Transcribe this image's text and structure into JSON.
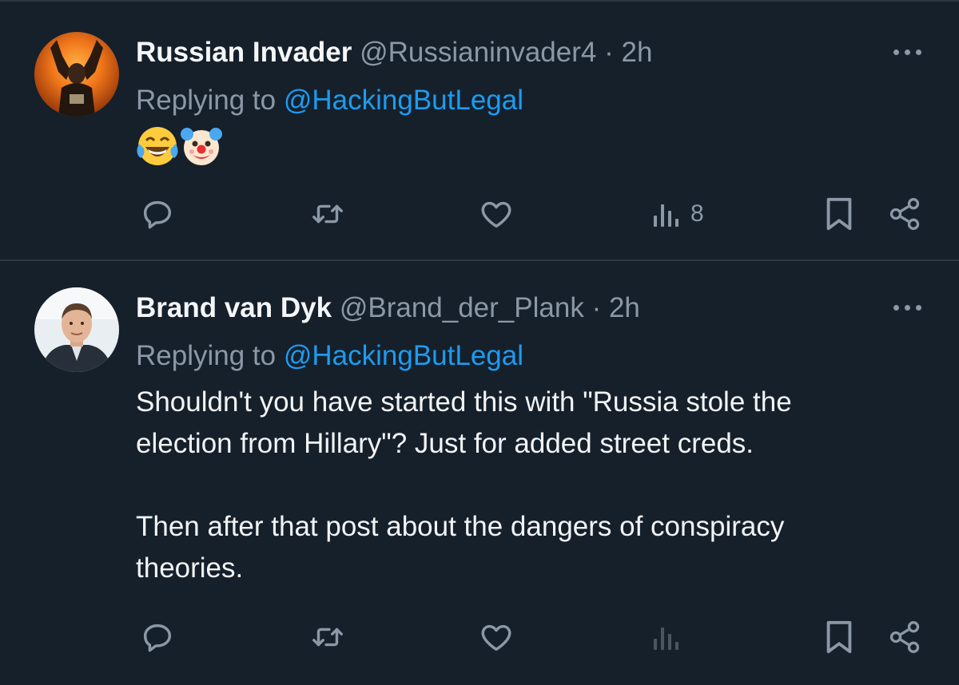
{
  "tweets": [
    {
      "author": {
        "name": "Russian Invader",
        "handle": "@Russianinvader4"
      },
      "separator": "·",
      "time": "2h",
      "replying_prefix": "Replying to",
      "replying_to": "@HackingButLegal",
      "emojis": [
        "face-with-tears-of-joy",
        "clown-face"
      ],
      "actions": {
        "views_count": "8"
      }
    },
    {
      "author": {
        "name": "Brand van Dyk",
        "handle": "@Brand_der_Plank"
      },
      "separator": "·",
      "time": "2h",
      "replying_prefix": "Replying to",
      "replying_to": "@HackingButLegal",
      "text_lines": [
        "Shouldn't you have started this with \"Russia stole the",
        "election from Hillary\"? Just for added street creds.",
        "Then after that post about the dangers of conspiracy",
        "theories."
      ],
      "actions": {
        "views_count": ""
      }
    }
  ],
  "colors": {
    "background": "#16202b",
    "text_primary": "#f2f4f6",
    "text_secondary": "#8b98a5",
    "link": "#1d9bf0",
    "divider": "#2f3943"
  },
  "icons": [
    "reply-icon",
    "retweet-icon",
    "like-icon",
    "views-icon",
    "bookmark-icon",
    "share-icon",
    "more-icon"
  ]
}
